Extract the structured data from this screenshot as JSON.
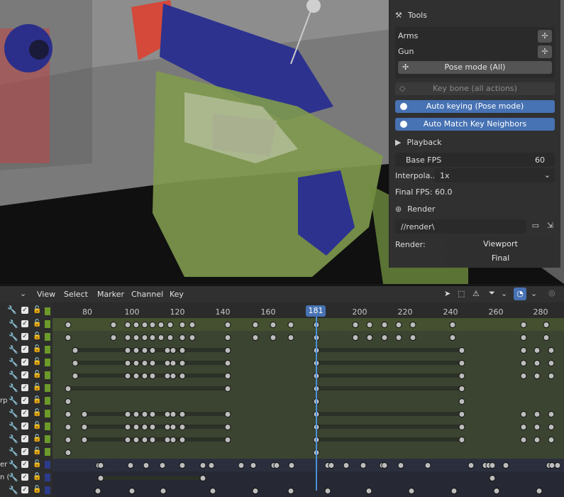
{
  "npanel": {
    "section_tools": "Tools",
    "item_arms": "Arms",
    "item_gun": "Gun",
    "pose_mode_all": "Pose mode (All)",
    "key_bone_all": "Key bone (all actions)",
    "auto_keying": "Auto keying (Pose mode)",
    "auto_match": "Auto Match Key Neighbors",
    "section_playback": "Playback",
    "base_fps_label": "Base FPS",
    "base_fps_value": "60",
    "interp_label": "Interpola...",
    "interp_value": "1x",
    "final_fps": "Final FPS: 60.0",
    "section_render": "Render",
    "render_path": "//render\\",
    "render_label": "Render:",
    "render_viewport": "Viewport",
    "render_final": "Final"
  },
  "header": {
    "menus": [
      "View",
      "Select",
      "Marker",
      "Channel",
      "Key"
    ]
  },
  "ruler": {
    "ticks": [
      "80",
      "100",
      "120",
      "140",
      "160",
      "200",
      "220",
      "240",
      "260",
      "280"
    ],
    "current_frame": "181"
  },
  "channels": {
    "partial_labels": [
      "rp",
      "er",
      "n ("
    ]
  },
  "colors": {
    "accent": "#4772b3",
    "group_green": "#6b9a2a",
    "group_blue": "#2c3b8a",
    "playhead": "#4a90d9"
  }
}
